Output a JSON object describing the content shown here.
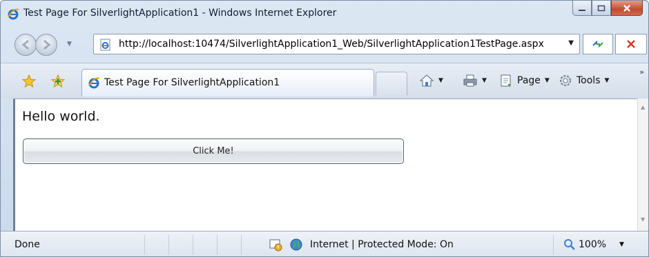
{
  "window": {
    "title": "Test Page For SilverlightApplication1 - Windows Internet Explorer",
    "minimize_label": "minimize",
    "maximize_label": "maximize",
    "close_label": "close"
  },
  "address_bar": {
    "url": "http://localhost:10474/SilverlightApplication1_Web/SilverlightApplication1TestPage.aspx"
  },
  "tab": {
    "label": "Test Page For SilverlightApplication1"
  },
  "commands": {
    "page_label": "Page",
    "tools_label": "Tools"
  },
  "content": {
    "greeting": "Hello world.",
    "button_label": "Click Me!"
  },
  "status": {
    "text": "Done",
    "zone": "Internet | Protected Mode: On",
    "zoom": "100%"
  },
  "icons": {
    "app": "ie-logo-icon",
    "back": "back-arrow-icon",
    "forward": "forward-arrow-icon",
    "refresh": "refresh-icon",
    "stop": "stop-icon",
    "favorites": "favorites-star-icon",
    "add_favorite": "add-favorite-icon",
    "home": "home-icon",
    "print": "print-icon",
    "page": "page-icon",
    "tools": "gear-icon",
    "zone": "globe-icon",
    "zoom": "magnifier-icon"
  },
  "colors": {
    "chrome": "#dce7f3",
    "close_button": "#c24a33",
    "accent": "#2a6fc9"
  }
}
